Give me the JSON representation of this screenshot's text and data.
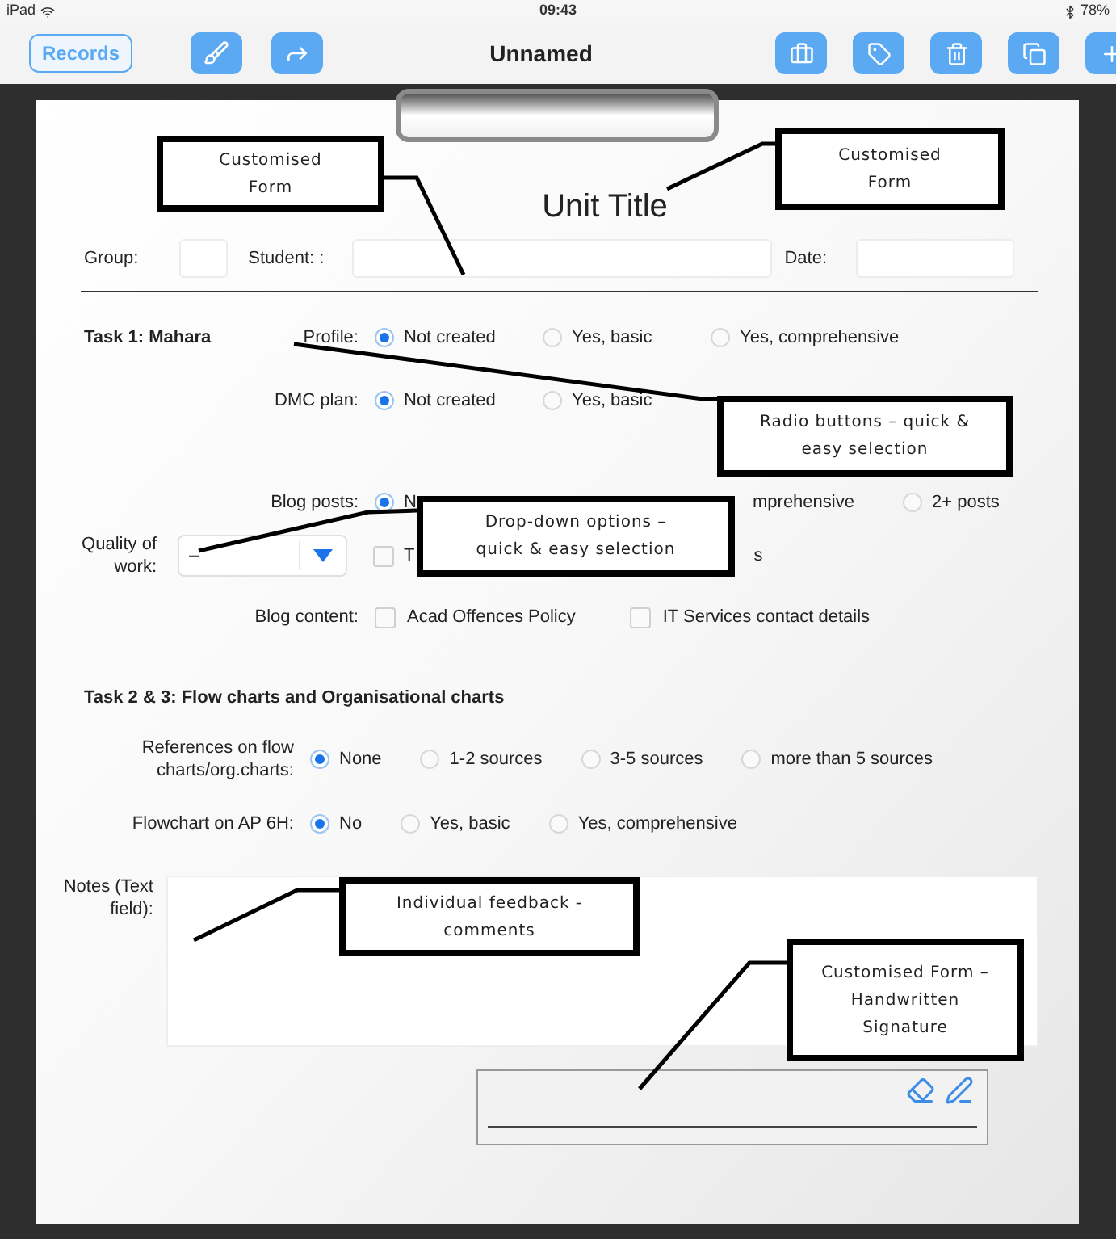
{
  "status_bar": {
    "carrier": "iPad",
    "time": "09:43",
    "battery": "78%"
  },
  "toolbar": {
    "records_button": "Records",
    "title": "Unnamed"
  },
  "form": {
    "title": "Unit Title",
    "header_fields": [
      {
        "label": "Group:"
      },
      {
        "label": "Student: :"
      },
      {
        "label": "Date:"
      }
    ],
    "sections": [
      {
        "heading": "Task 1: Mahara",
        "rows": [
          {
            "kind": "radio",
            "label": "Profile:",
            "options": [
              {
                "label": "Not created",
                "selected": true
              },
              {
                "label": "Yes, basic",
                "selected": false
              },
              {
                "label": "Yes, comprehensive",
                "selected": false
              }
            ]
          },
          {
            "kind": "radio",
            "label": "DMC plan:",
            "options": [
              {
                "label": "Not created",
                "selected": true
              },
              {
                "label": "Yes, basic",
                "selected": false
              }
            ]
          },
          {
            "kind": "radio",
            "label": "Blog posts:",
            "options": [
              {
                "label": "N",
                "selected": true
              },
              {
                "label": "mprehensive",
                "cut": true
              },
              {
                "label": "2+ posts",
                "selected": false
              }
            ]
          },
          {
            "kind": "dropdown",
            "label": "Quality of work:",
            "value": "–",
            "options": [
              {
                "label": "T",
                "checked": false
              },
              {
                "label": "s",
                "cut": true
              }
            ]
          },
          {
            "kind": "checkbox",
            "label": "Blog content:",
            "options": [
              {
                "label": "Acad Offences Policy",
                "checked": false
              },
              {
                "label": "IT Services contact details",
                "checked": false
              }
            ]
          }
        ]
      },
      {
        "heading": "Task 2 & 3: Flow charts and Organisational charts",
        "rows": [
          {
            "kind": "radio",
            "label": "References on flow charts/org.charts:",
            "options": [
              {
                "label": "None",
                "selected": true
              },
              {
                "label": "1-2 sources",
                "selected": false
              },
              {
                "label": "3-5 sources",
                "selected": false
              },
              {
                "label": "more than 5 sources",
                "selected": false
              }
            ]
          },
          {
            "kind": "radio",
            "label": "Flowchart on AP 6H:",
            "options": [
              {
                "label": "No",
                "selected": true
              },
              {
                "label": "Yes, basic",
                "selected": false
              },
              {
                "label": "Yes, comprehensive",
                "selected": false
              }
            ]
          }
        ]
      }
    ],
    "notes": {
      "label": "Notes (Text field):"
    }
  },
  "callouts": [
    {
      "text": "Customised Form"
    },
    {
      "text": "Customised Form"
    },
    {
      "text": "Radio buttons – quick & easy selection"
    },
    {
      "text": "Drop-down options – quick & easy selection"
    },
    {
      "text": "Individual feedback - comments"
    },
    {
      "text": "Customised Form – Handwritten Signature"
    }
  ]
}
